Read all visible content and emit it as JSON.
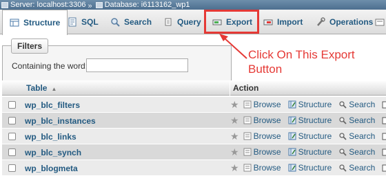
{
  "breadcrumb": {
    "server": "Server: localhost:3306",
    "separator": "»",
    "database": "Database: i6113162_wp1"
  },
  "tabs": [
    {
      "label": "Structure",
      "icon": "structure-icon"
    },
    {
      "label": "SQL",
      "icon": "sql-icon"
    },
    {
      "label": "Search",
      "icon": "search-icon"
    },
    {
      "label": "Query",
      "icon": "query-icon"
    },
    {
      "label": "Export",
      "icon": "export-icon"
    },
    {
      "label": "Import",
      "icon": "import-icon"
    },
    {
      "label": "Operations",
      "icon": "wrench-icon"
    }
  ],
  "annotation": {
    "line1": "Click On This Export",
    "line2": "Button",
    "color": "#e53935"
  },
  "filters": {
    "legend": "Filters",
    "label": "Containing the word:",
    "value": ""
  },
  "table": {
    "col_table": "Table",
    "col_action": "Action",
    "actions": [
      "Browse",
      "Structure",
      "Search"
    ],
    "rows": [
      "wp_blc_filters",
      "wp_blc_instances",
      "wp_blc_links",
      "wp_blc_synch",
      "wp_blogmeta"
    ]
  },
  "colors": {
    "link": "#235a81",
    "highlight": "#e53935"
  }
}
